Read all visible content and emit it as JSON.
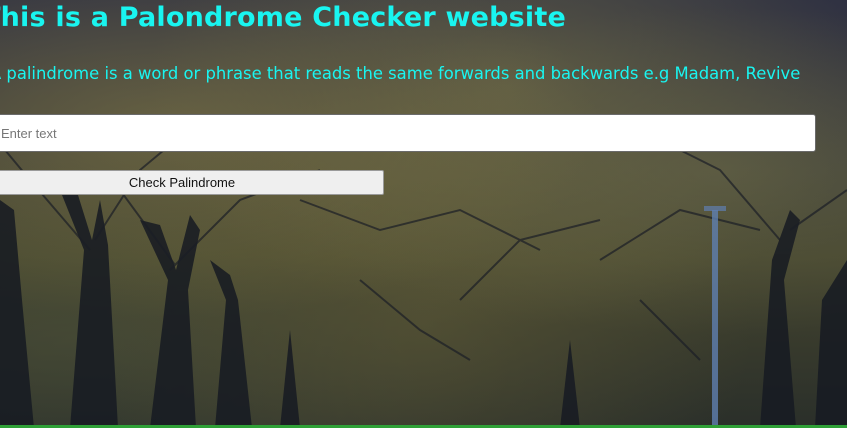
{
  "header": {
    "title": "This is a Palondrome Checker website",
    "description": "A palindrome is a word or phrase that reads the same forwards and backwards e.g Madam, Revive"
  },
  "form": {
    "input_placeholder": "Enter text",
    "input_value": "",
    "button_label": "Check Palindrome"
  },
  "colors": {
    "heading_text": "#19f5f0",
    "bottom_bar": "#2fa037"
  }
}
